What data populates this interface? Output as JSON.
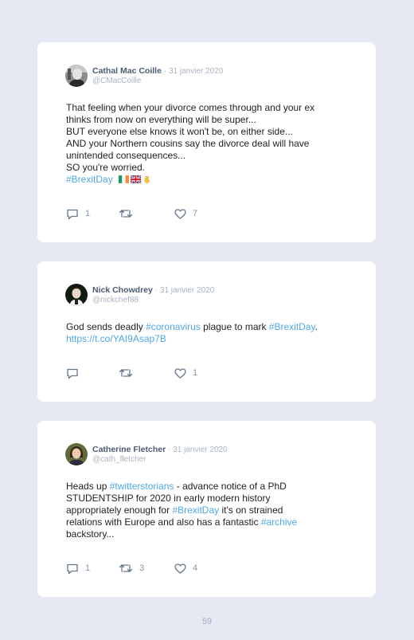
{
  "tweets": [
    {
      "author": "Cathal Mac Coille",
      "date": "· 31 janvier 2020",
      "handle": "@CMacCoille",
      "lines": [
        "That feeling when your divorce comes through and your ex",
        "thinks from now on everything will be super...",
        "BUT everyone else knows it won't be, on either side...",
        "AND your Northern cousins say the divorce deal will have",
        "unintended consequences...",
        "SO you're worried."
      ],
      "hashtag": "#BrexitDay",
      "emoji": [
        "irish-flag-icon",
        "uk-flag-icon",
        "crossed-fingers-icon"
      ],
      "replies": "1",
      "retweets": "",
      "likes": "7"
    },
    {
      "author": "Nick Chowdrey",
      "date": "· 31 janvier 2020",
      "handle": "@nickchef88",
      "line1": [
        "God sends deadly ",
        "#coronavirus",
        " plague to mark ",
        "#BrexitDay",
        "."
      ],
      "link": "https://t.co/YAI9Asap7B",
      "replies": "",
      "retweets": "",
      "likes": "1"
    },
    {
      "author": "Catherine Fletcher",
      "date": "· 31 janvier 2020",
      "handle": "@cath_fletcher",
      "line1": [
        "Heads up ",
        "#twitterstorians",
        " - advance notice of a PhD"
      ],
      "line2": "STUDENTSHIP for 2020 in early modern history",
      "line3": [
        "appropriately enough for ",
        "#BrexitDay",
        " it's on strained"
      ],
      "line4": [
        "relations with Europe and also has a fantastic ",
        "#archive"
      ],
      "line5": "backstory...",
      "replies": "1",
      "retweets": "3",
      "likes": "4"
    }
  ],
  "page_number": "59",
  "colors": {
    "background": "#e6e8f4",
    "hashtag": "#4fa8e8",
    "name": "#4a5b73",
    "meta": "#a9b4c2"
  }
}
